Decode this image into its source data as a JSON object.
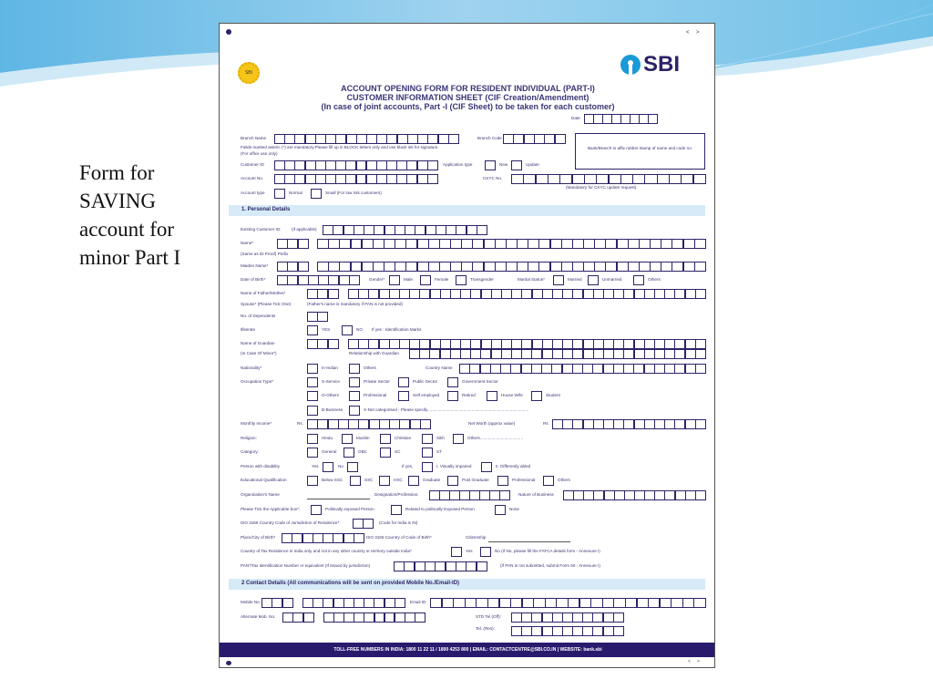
{
  "slide": {
    "text_lines": [
      "Form for",
      "SAVING",
      "account for",
      "minor Part I"
    ],
    "accent": "#5bb7e6"
  },
  "form": {
    "nav_prev": "<",
    "nav_next": ">",
    "logo": "SBI",
    "emblem_text": "SBI",
    "titles": [
      "ACCOUNT OPENING FORM FOR RESIDENT INDIVIDUAL (PART-I)",
      "CUSTOMER INFORMATION SHEET (CIF Creation/Amendment)",
      "(In case of joint accounts, Part -I (CIF Sheet) to be taken for each customer)"
    ],
    "labels": {
      "date": "Date",
      "branch_name": "Branch Name",
      "branch_code": "Branch Code",
      "stamp": "Bank/Branch to affix rubber stamp of name and code no.",
      "note": "Fields marked asteric (*) are mandatory.Please fill up in BLOCK letters only and use black ink for signature",
      "office": "(For office use only)",
      "customer_id": "Customer ID",
      "app_type": "Application type",
      "new": "New",
      "update": "Update",
      "account_no": "Account No.",
      "ckyc": "CKYC No.",
      "ckyc_note": "(Mandatory for CKYC update request)",
      "account_type": "Account type",
      "normal": "Normal",
      "small": "Small (For low risk customers)",
      "sec1": "1. Personal Details",
      "existing": "Existing Customer ID:",
      "applicable": "(If applicable)",
      "name": "Name*",
      "same_as": "(Same as ID Proof) Prefix",
      "maiden": "Maiden Name*",
      "dob": "Date of Birth*",
      "gender": "Gender*",
      "male": "Male",
      "female": "Female",
      "transgender": "Transgender",
      "marital": "Marital Status*",
      "married": "Married",
      "unmarried": "Unmarried",
      "others": "Others",
      "father": "Name of Father/Mother/",
      "spouse": "Spouse* (Please Tick One)",
      "father_note": "(Father's name is mandatory if PAN is not provided)",
      "dependents": "No. of Dependents",
      "illiterate": "Illiterate",
      "yes_caps": "YES",
      "no_caps": "NO",
      "id_marks": "If yes : Identification Marks",
      "guardian": "Name of Guardian",
      "minor": "(In Case Of Minor*)",
      "relationship": "Relationship with Guardian",
      "nationality": "Nationality*",
      "in_indian": "In-Indian",
      "country_name": "Country Name",
      "occupation": "Occupation Type*",
      "s_service": "S-Service",
      "private": "Private Sector",
      "public": "Public Sector",
      "govt": "Government Sector",
      "o_others": "O-Others",
      "professional": "Professional",
      "self": "Self employed",
      "retired": "Retired",
      "housewife": "House Wife",
      "student": "Student",
      "b_business": "B-Business",
      "x_not": "X-Not categorised - Please specify.......................................................................................",
      "income": "Monthly Income*",
      "rs": "Rs.",
      "networth": "Net Worth (approx value)",
      "rs2": "Rs",
      "religion": "Religion:",
      "hindu": "Hindu",
      "muslim": "Muslim",
      "christian": "Christian",
      "sikh": "Sikh",
      "rel_others": "Others.....................................",
      "category": "Category:",
      "general": "General",
      "obc": "OBC",
      "sc": "SC",
      "st": "ST",
      "disability": "Person with disability",
      "yes": "Yes",
      "no": "No",
      "if_yes": "If yes,",
      "visually": "I. Visually impaired",
      "differently": "II. Differently abled",
      "education": "Educational Qualification",
      "below_ssc": "Below SSC",
      "ssc": "SSC",
      "hsc": "HSC",
      "graduate": "Graduate",
      "post_graduate": "Post Graduate",
      "edu_prof": "Professional",
      "edu_others": "Others",
      "org": "Organization's Name",
      "designation": "Designation/Profession:",
      "nature": "Nature of Business",
      "tick": "Please Tick the Applicable box*:",
      "pep": "Politically exposed Person",
      "related_pep": "Related to politically Exposed Person",
      "none": "None",
      "iso_res": "ISO 3166 Country Code of Jurisdiction of Residence*",
      "india_code": "(Code for India is IN)",
      "place": "Place/City of Birth*",
      "iso_birth": "ISO 3166 Country of Code of Birth*",
      "citizenship": "Citizenship",
      "tax": "Country of Tax Residence in India only and not in any other country or territory outside India*",
      "tax_no": "No (If No, please fill the FATCA details form - Annexure I)",
      "pan": "PAN*/Tax Identification Number or equivalent (If issued by jurisdiction)",
      "pan_note": "(If PAN is not submitted, submit Form 60 - Annexure I)",
      "sec2": "2 Contact Details (All communications will be sent on provided Mobile No./Email-ID)",
      "mobile": "Mobile No.",
      "email": "Email ID",
      "alt_mobile": "Alternate Mob. No.",
      "std_off": "STD Tel (Off):",
      "tel_res": "Tel. (Res):"
    },
    "footer": "TOLL-FREE NUMBERS IN INDIA: 1800 11 22 11 / 1800 4253 800  |  EMAIL: CONTACTCENTRE@SBI.CO.IN  |  WEBSITE: bank.sbi",
    "colors": {
      "ink": "#2d2366",
      "band": "#d6ebf7",
      "footer": "#2a1a6e",
      "logo": "#1a9ad6",
      "logo_text": "#2d2366"
    }
  }
}
